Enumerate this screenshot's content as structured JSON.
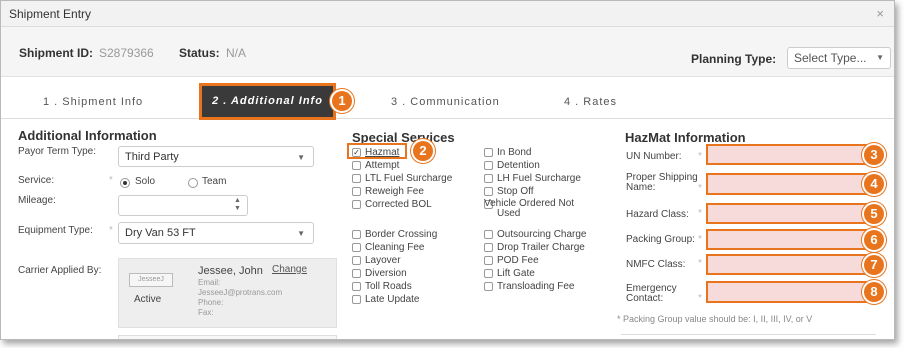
{
  "title": "Shipment Entry",
  "close_glyph": "×",
  "header": {
    "shipment_id_label": "Shipment ID:",
    "shipment_id": "S2879366",
    "status_label": "Status:",
    "status": "N/A",
    "planning_type_label": "Planning Type:",
    "planning_type_value": "Select Type..."
  },
  "tabs": [
    {
      "label": "1 . Shipment Info"
    },
    {
      "label": "2 . Additional Info"
    },
    {
      "label": "3 . Communication"
    },
    {
      "label": "4 . Rates"
    }
  ],
  "badges": [
    "1",
    "2",
    "3",
    "4",
    "5",
    "6",
    "7",
    "8"
  ],
  "additional": {
    "heading": "Additional Information",
    "payor_label": "Payor Term Type:",
    "payor_value": "Third Party",
    "service_label": "Service:",
    "service_options": [
      "Solo",
      "Team"
    ],
    "mileage_label": "Mileage:",
    "mileage_value": "",
    "equipment_label": "Equipment Type:",
    "equipment_value": "Dry Van 53 FT",
    "carrier_label": "Carrier Applied By:",
    "carrier": {
      "avatar": "JesseeJ",
      "status": "Active",
      "name": "Jessee, John",
      "change": "Change",
      "email_label": "Email:",
      "email": "JesseeJ@protrans.com",
      "phone_label": "Phone:",
      "fax_label": "Fax:"
    }
  },
  "special": {
    "heading": "Special Services",
    "col1": [
      {
        "label": "Hazmat",
        "checked": true
      },
      {
        "label": "Attempt"
      },
      {
        "label": "LTL Fuel Surcharge"
      },
      {
        "label": "Reweigh Fee"
      },
      {
        "label": "Corrected BOL"
      },
      {
        "label": "Border Crossing"
      },
      {
        "label": "Cleaning Fee"
      },
      {
        "label": "Layover"
      },
      {
        "label": "Diversion"
      },
      {
        "label": "Toll Roads"
      },
      {
        "label": "Late Update"
      }
    ],
    "col2": [
      {
        "label": "In Bond"
      },
      {
        "label": "Detention"
      },
      {
        "label": "LH Fuel Surcharge"
      },
      {
        "label": "Stop Off"
      },
      {
        "label": "Vehicle Ordered Not Used"
      },
      {
        "label": "Outsourcing Charge"
      },
      {
        "label": "Drop Trailer Charge"
      },
      {
        "label": "POD Fee"
      },
      {
        "label": "Lift Gate"
      },
      {
        "label": "Transloading Fee"
      }
    ]
  },
  "hazmat": {
    "heading": "HazMat Information",
    "fields": [
      {
        "label": "UN Number:"
      },
      {
        "label": "Proper Shipping Name:"
      },
      {
        "label": "Hazard Class:"
      },
      {
        "label": "Packing Group:"
      },
      {
        "label": "NMFC Class:"
      },
      {
        "label": "Emergency Contact:"
      }
    ],
    "required_mark": "*",
    "note": "* Packing Group value should be: I, II, III, IV, or V"
  }
}
